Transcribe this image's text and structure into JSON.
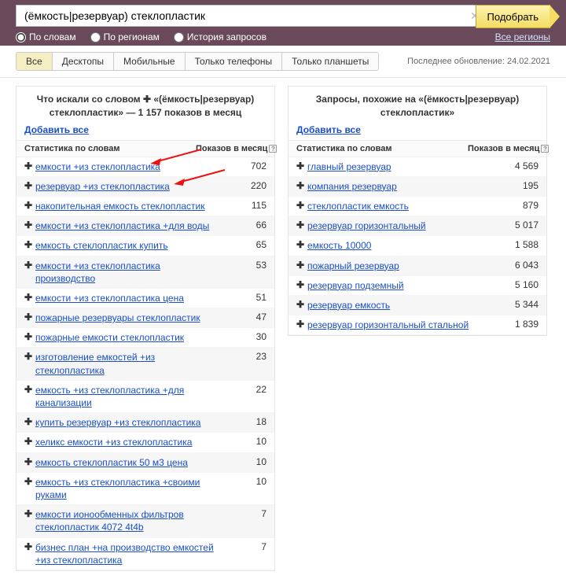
{
  "search": {
    "value": "(ёмкость|резервуар) стеклопластик",
    "submit_label": "Подобрать",
    "clear_icon": "✕"
  },
  "radios": {
    "by_words": "По словам",
    "by_regions": "По регионам",
    "history": "История запросов"
  },
  "all_regions": "Все регионы",
  "device_tabs": {
    "all": "Все",
    "desktops": "Десктопы",
    "mobile": "Мобильные",
    "phones": "Только телефоны",
    "tablets": "Только планшеты"
  },
  "last_update": "Последнее обновление: 24.02.2021",
  "left": {
    "title": "Что искали со словом ✚ «(ёмкость|резервуар) стеклопластик» — 1 157 показов в месяц",
    "add_all": "Добавить все",
    "hdr_q": "Статистика по словам",
    "hdr_n": "Показов в месяц",
    "rows": [
      {
        "q": "емкости +из стеклопластика",
        "n": "702"
      },
      {
        "q": "резервуар +из стеклопластика",
        "n": "220"
      },
      {
        "q": "накопительная емкость стеклопластик",
        "n": "115"
      },
      {
        "q": "емкости +из стеклопластика +для воды",
        "n": "66"
      },
      {
        "q": "емкость стеклопластик купить",
        "n": "65"
      },
      {
        "q": "емкости +из стеклопластика производство",
        "n": "53"
      },
      {
        "q": "емкости +из стеклопластика цена",
        "n": "51"
      },
      {
        "q": "пожарные резервуары стеклопластик",
        "n": "47"
      },
      {
        "q": "пожарные емкости стеклопластик",
        "n": "30"
      },
      {
        "q": "изготовление емкостей +из стеклопластика",
        "n": "23"
      },
      {
        "q": "емкость +из стеклопластика +для канализации",
        "n": "22"
      },
      {
        "q": "купить резервуар +из стеклопластика",
        "n": "18"
      },
      {
        "q": "хеликс емкости +из стеклопластика",
        "n": "10"
      },
      {
        "q": "емкость стеклопластик 50 м3 цена",
        "n": "10"
      },
      {
        "q": "емкость +из стеклопластика +своими руками",
        "n": "10"
      },
      {
        "q": "  емкости ионообменных фильтров стеклопластик 4072 4t4b",
        "n": "7"
      },
      {
        "q": "  бизнес план +на производство емкостей +из стеклопластика",
        "n": "7"
      }
    ]
  },
  "right": {
    "title": "Запросы, похожие на «(ёмкость|резервуар) стеклопластик»",
    "add_all": "Добавить все",
    "hdr_q": "Статистика по словам",
    "hdr_n": "Показов в месяц",
    "rows": [
      {
        "q": "главный резервуар",
        "n": "4 569"
      },
      {
        "q": "компания резервуар",
        "n": "195"
      },
      {
        "q": "стеклопластик емкость",
        "n": "879"
      },
      {
        "q": "резервуар горизонтальный",
        "n": "5 017"
      },
      {
        "q": "емкость 10000",
        "n": "1 588"
      },
      {
        "q": "пожарный резервуар",
        "n": "6 043"
      },
      {
        "q": "резервуар подземный",
        "n": "5 160"
      },
      {
        "q": "резервуар емкость",
        "n": "5 344"
      },
      {
        "q": "резервуар горизонтальный стальной",
        "n": "1 839"
      }
    ]
  }
}
